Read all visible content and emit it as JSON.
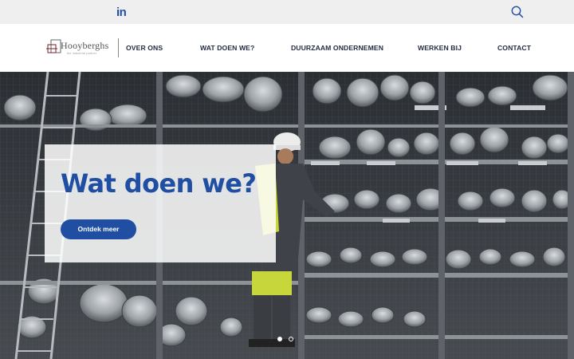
{
  "topbar": {
    "linkedin_label": "in",
    "linkedin_icon": "linkedin-icon",
    "search_icon": "search-icon",
    "icon_color": "#1f4ea3"
  },
  "header": {
    "logo_text": "Hooyberghs",
    "logo_tagline": "the industrial partner",
    "nav": [
      {
        "label": "OVER ONS"
      },
      {
        "label": "WAT DOEN WE?"
      },
      {
        "label": "DUURZAAM ONDERNEMEN"
      },
      {
        "label": "WERKEN BIJ"
      },
      {
        "label": "CONTACT"
      }
    ]
  },
  "hero": {
    "title": "Wat doen we?",
    "cta_label": "Ontdek meer",
    "accent": "#1f4ea3",
    "slides": 2,
    "active_slide": 1
  }
}
